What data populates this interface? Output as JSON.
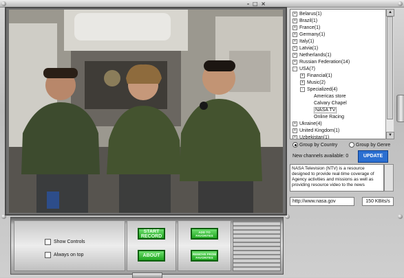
{
  "window": {
    "buttons": [
      "-",
      "□",
      "×"
    ],
    "button_labels": [
      "minimize",
      "maximize",
      "close"
    ]
  },
  "channels": {
    "tree": [
      {
        "label": "Belarus(1)",
        "expander": "+",
        "level": 0
      },
      {
        "label": "Brazil(1)",
        "expander": "+",
        "level": 0
      },
      {
        "label": "France(1)",
        "expander": "+",
        "level": 0
      },
      {
        "label": "Germany(1)",
        "expander": "+",
        "level": 0
      },
      {
        "label": "Italy(1)",
        "expander": "+",
        "level": 0
      },
      {
        "label": "Latvia(1)",
        "expander": "+",
        "level": 0
      },
      {
        "label": "Netherlands(1)",
        "expander": "+",
        "level": 0
      },
      {
        "label": "Russian Federation(14)",
        "expander": "+",
        "level": 0
      },
      {
        "label": "USA(7)",
        "expander": "-",
        "level": 0
      },
      {
        "label": "Financial(1)",
        "expander": "+",
        "level": 1
      },
      {
        "label": "Music(2)",
        "expander": "+",
        "level": 1
      },
      {
        "label": "Specialized(4)",
        "expander": "-",
        "level": 1
      },
      {
        "label": "Americas store",
        "expander": "",
        "level": 2
      },
      {
        "label": "Calvary Chapel",
        "expander": "",
        "level": 2
      },
      {
        "label": "NASA TV",
        "expander": "",
        "level": 2,
        "selected": true
      },
      {
        "label": "Online Racing",
        "expander": "",
        "level": 2
      },
      {
        "label": "Ukraine(4)",
        "expander": "+",
        "level": 0
      },
      {
        "label": "United Kingdom(1)",
        "expander": "+",
        "level": 0
      },
      {
        "label": "Uzbekistan(1)",
        "expander": "+",
        "level": 0
      }
    ]
  },
  "groupby": {
    "country": "Group by Country",
    "genre": "Group by Genre",
    "selected": "country"
  },
  "new_channels": "New channels available: 0",
  "update_label": "UPDATE",
  "description": "NASA Television (NTV) is a resource designed to provide real-time coverage of Agency activities and missions as well as providing resource video to the news",
  "url": "http://www.nasa.gov",
  "bitrate": "150 KBits/s",
  "controls": {
    "show_controls": "Show Controls",
    "always_on_top": "Always on top",
    "start_record": "START RECORD",
    "about": "ABOUT",
    "add_favorites": "ADD TO FAVORITES",
    "remove_favorites": "REMOVE FROM FAVORITES"
  },
  "colors": {
    "update_button": "#2b6fd1",
    "green_button": "#1ea51e"
  }
}
